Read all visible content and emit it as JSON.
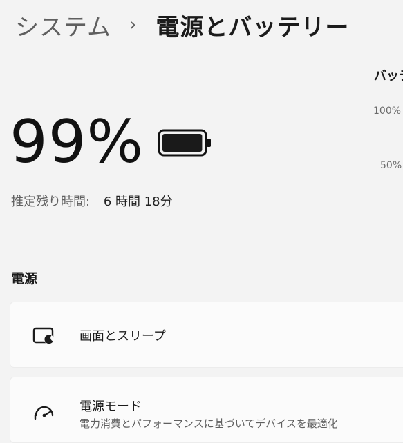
{
  "breadcrumb": {
    "parent": "システム",
    "separator": "›",
    "current": "電源とバッテリー"
  },
  "battery": {
    "percent_text": "99%",
    "level": 0.99,
    "icon": "battery-full-icon",
    "time_remaining_label": "推定残り時間:",
    "time_remaining_value": "6 時間 18分"
  },
  "battery_chart": {
    "title": "バッテ",
    "ticks": [
      "100%",
      "50%"
    ]
  },
  "power_section": {
    "title": "電源",
    "items": [
      {
        "title": "画面とスリープ",
        "icon": "screen-sleep-icon"
      },
      {
        "title": "電源モード",
        "description": "電力消費とパフォーマンスに基づいてデバイスを最適化",
        "icon": "power-mode-gauge-icon"
      }
    ]
  }
}
